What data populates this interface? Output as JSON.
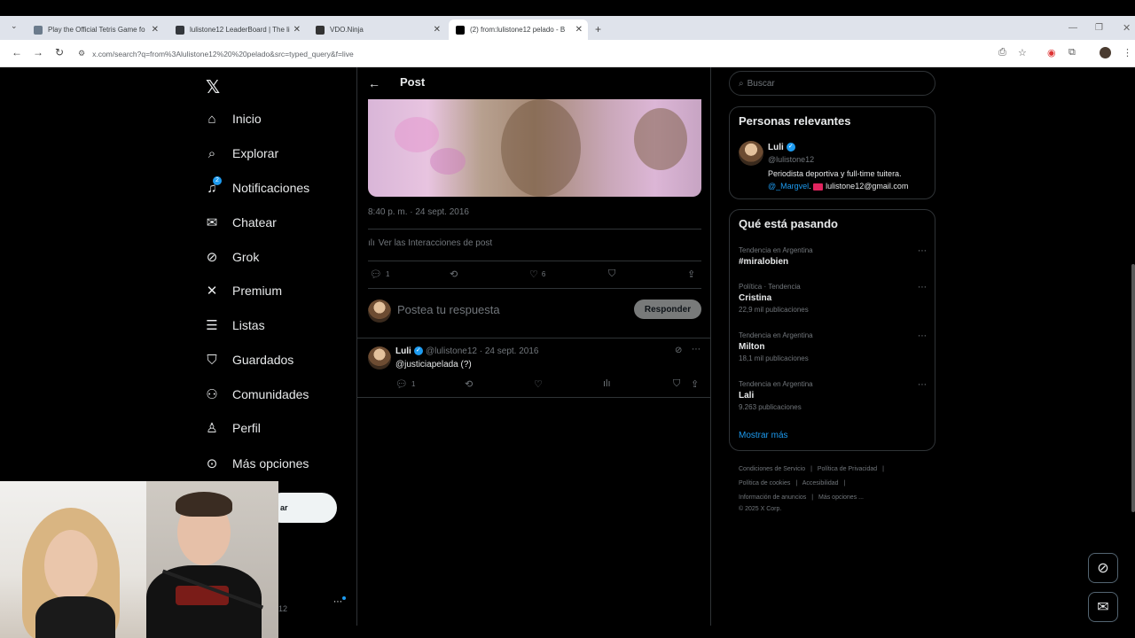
{
  "browser": {
    "tabs": [
      {
        "title": "Play the Official Tetris Game fo",
        "favicon_color": "#6b7b8c"
      },
      {
        "title": "lulistone12 LeaderBoard | The li",
        "favicon_color": "#34373c"
      },
      {
        "title": "VDO.Ninja",
        "favicon_color": "#333333"
      },
      {
        "title": "(2) from:lulistone12 pelado - B",
        "favicon_color": "#000000"
      }
    ],
    "new_tab": "+",
    "url": "x.com/search?q=from%3Alulistone12%20%20pelado&src=typed_query&f=live"
  },
  "nav": {
    "items": [
      {
        "label": "Inicio",
        "icon": "home-icon",
        "glyph": "⌂"
      },
      {
        "label": "Explorar",
        "icon": "search-icon",
        "glyph": "⌕"
      },
      {
        "label": "Notificaciones",
        "icon": "bell-icon",
        "glyph": "🔔︎",
        "badge": "2"
      },
      {
        "label": "Chatear",
        "icon": "mail-icon",
        "glyph": "✉"
      },
      {
        "label": "Grok",
        "icon": "grok-icon",
        "glyph": "⊘"
      },
      {
        "label": "Premium",
        "icon": "x-icon",
        "glyph": "𝕏"
      },
      {
        "label": "Listas",
        "icon": "list-icon",
        "glyph": "☰"
      },
      {
        "label": "Guardados",
        "icon": "bookmark-icon",
        "glyph": "⛉"
      },
      {
        "label": "Comunidades",
        "icon": "communities-icon",
        "glyph": "⚇"
      },
      {
        "label": "Perfil",
        "icon": "profile-icon",
        "glyph": "⚲"
      },
      {
        "label": "Más opciones",
        "icon": "more-icon",
        "glyph": "⋯"
      }
    ],
    "post_button": "ar",
    "handle_tail": "12"
  },
  "post": {
    "title": "Post",
    "time": "8:40 p. m. · 24 sept. 2016",
    "interactions": "Ver las Interacciones de post",
    "replies": "1",
    "likes": "6",
    "reply_placeholder": "Postea tu respuesta",
    "reply_button": "Responder"
  },
  "reply": {
    "name": "Luli",
    "handle_date": "@lulistone12 · 24 sept. 2016",
    "text": "@justiciapelada (?)",
    "replies": "1"
  },
  "sidebar": {
    "search_placeholder": "Buscar",
    "relevant_title": "Personas relevantes",
    "person_name": "Luli",
    "person_handle": "@lulistone12",
    "person_bio_1": "Periodista deportiva y full-time tuitera.",
    "person_bio_link": "@_Margvel",
    "person_bio_2": "lulistone12@gmail.com",
    "trends_title": "Qué está pasando",
    "trends": [
      {
        "context": "Tendencia en Argentina",
        "name": "#miralobien",
        "count": ""
      },
      {
        "context": "Política · Tendencia",
        "name": "Cristina",
        "count": "22,9 mil publicaciones"
      },
      {
        "context": "Tendencia en Argentina",
        "name": "Milton",
        "count": "18,1 mil publicaciones"
      },
      {
        "context": "Tendencia en Argentina",
        "name": "Lali",
        "count": "9.263 publicaciones"
      }
    ],
    "show_more": "Mostrar más",
    "footer": [
      "Condiciones de Servicio",
      "|",
      "Política de Privacidad",
      "|",
      "Política de cookies",
      "|",
      "Accesibilidad",
      "|",
      "Información de anuncios",
      "|",
      "Más opciones ...",
      "© 2025 X Corp."
    ]
  },
  "colors": {
    "accent": "#1d9bf0",
    "background": "#000000",
    "muted": "#71767b"
  }
}
